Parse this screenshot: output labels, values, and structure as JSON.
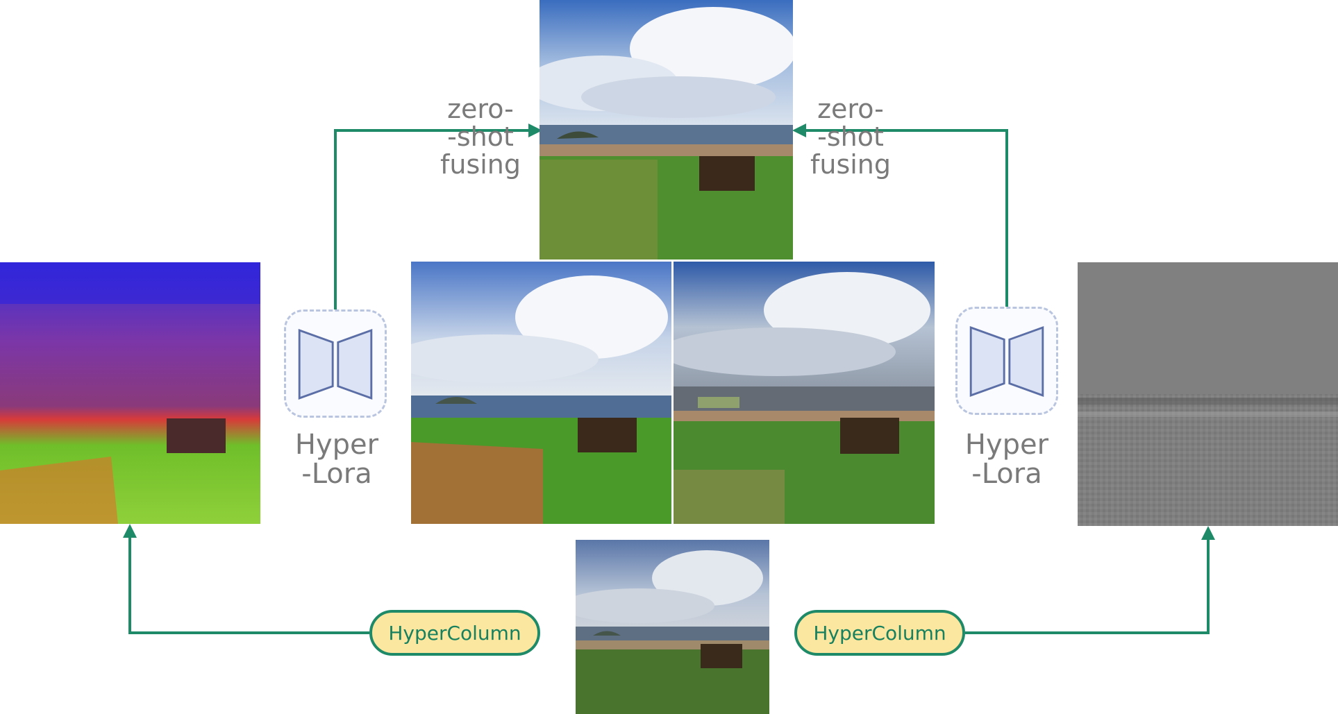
{
  "colors": {
    "connector": "#1f8a68",
    "pill_fill": "#fbe7a0",
    "pill_border": "#1f8a68",
    "unet_fill": "#dbe3f4",
    "unet_stroke": "#5b6ea6",
    "unet_box_border": "#b9c4df",
    "label_text": "#7a7a7a"
  },
  "labels": {
    "zero_shot_left": "zero-\n-shot\nfusing",
    "zero_shot_right": "zero-\n-shot\nfusing",
    "hyperlora_left": "Hyper\n-Lora",
    "hyperlora_right": "Hyper\n-Lora",
    "hypercolumn_left": "HyperColumn",
    "hypercolumn_right": "HyperColumn"
  },
  "icons": {
    "unet_left": "unet-encoder-decoder-icon",
    "unet_right": "unet-encoder-decoder-icon"
  },
  "panels": {
    "fused_output": "zero-shot fused landscape",
    "left_output": "hyperlora stylized landscape left",
    "right_output": "hyperlora stylized landscape right",
    "input": "source landscape photo",
    "color_feature": "hypercolumn color feature map",
    "gray_feature": "hypercolumn gray feature map"
  }
}
